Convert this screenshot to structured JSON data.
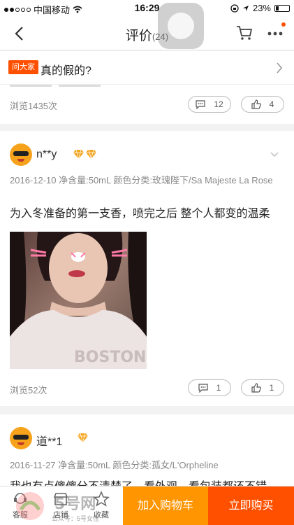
{
  "status_bar": {
    "carrier": "中国移动",
    "time": "16:29",
    "battery": "23%",
    "battery_level": 0.23
  },
  "nav": {
    "title": "评价",
    "count": "(24)"
  },
  "ask": {
    "tag": "问大家",
    "question": "真的假的?",
    "views": "浏览1435次",
    "comments": "12",
    "likes": "4"
  },
  "reviews": [
    {
      "user": "n**y",
      "diamonds": 2,
      "meta": "2016-12-10  净含量:50mL  颜色分类:玫瑰陛下/Sa Majeste La Rose",
      "text": "为入冬准备的第一支香，喷完之后 整个人都变的温柔",
      "views": "浏览52次",
      "comments": "1",
      "likes": "1"
    },
    {
      "user": "道**1",
      "diamonds": 1,
      "meta": "2016-11-27  净含量:50mL  颜色分类:孤女/L'Orpheline",
      "text": "我也有点傻傻分不清楚了，看外观，看包装都还不错"
    }
  ],
  "photo_text": "BOSTON",
  "bottom_bar": {
    "items": [
      {
        "label": "客服"
      },
      {
        "label": "店铺"
      },
      {
        "label": "收藏"
      }
    ],
    "add_to_cart": "加入购物车",
    "buy_now": "立即购买"
  },
  "watermark": {
    "logo": "5号网",
    "sub": "公众号：5号女性"
  },
  "colors": {
    "accent": "#ff5000",
    "cart_button": "#ff9500",
    "diamond": "#f5a623"
  }
}
